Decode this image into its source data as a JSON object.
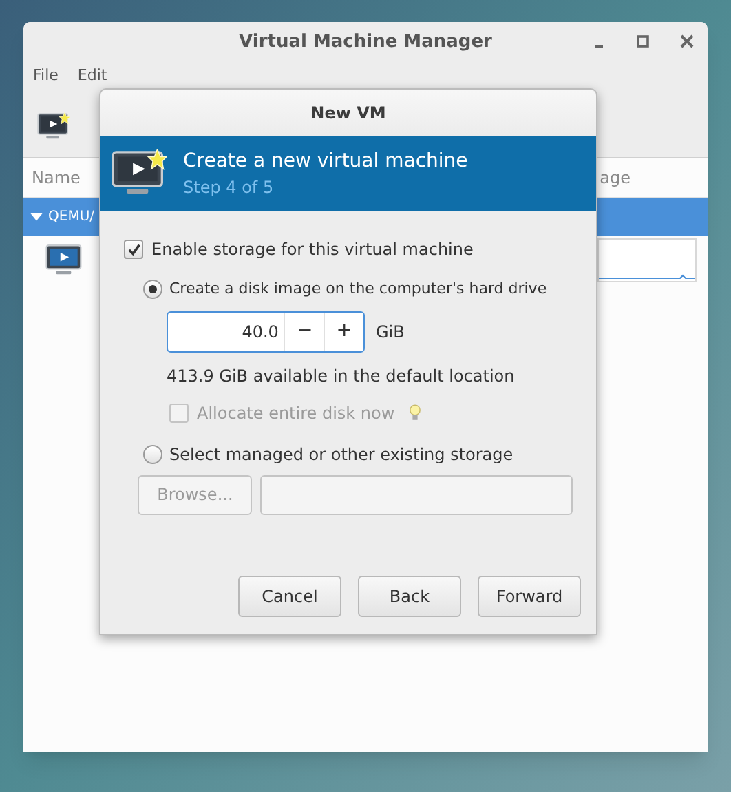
{
  "window": {
    "title": "Virtual Machine Manager"
  },
  "menu": [
    "File",
    "Edit"
  ],
  "table": {
    "columns": [
      "Name",
      "age"
    ],
    "group": {
      "label": "QEMU/",
      "expanded": true,
      "selected": true
    }
  },
  "dialog": {
    "title": "New VM",
    "banner": {
      "title": "Create a new virtual machine",
      "subtitle": "Step 4 of 5"
    },
    "enable_storage": {
      "label": "Enable storage for this virtual machine",
      "checked": true
    },
    "options": [
      {
        "label": "Create a disk image on the computer's hard drive",
        "selected": true
      },
      {
        "label": "Select managed or other existing storage",
        "selected": false
      }
    ],
    "size": {
      "value": "40.0",
      "decrement": "−",
      "increment": "+",
      "unit": "GiB"
    },
    "available": "413.9 GiB available in the default location",
    "allocate": {
      "label": "Allocate entire disk now",
      "checked": false,
      "disabled": true
    },
    "browse": {
      "label": "Browse...",
      "disabled": true
    },
    "buttons": [
      "Cancel",
      "Back",
      "Forward"
    ]
  }
}
